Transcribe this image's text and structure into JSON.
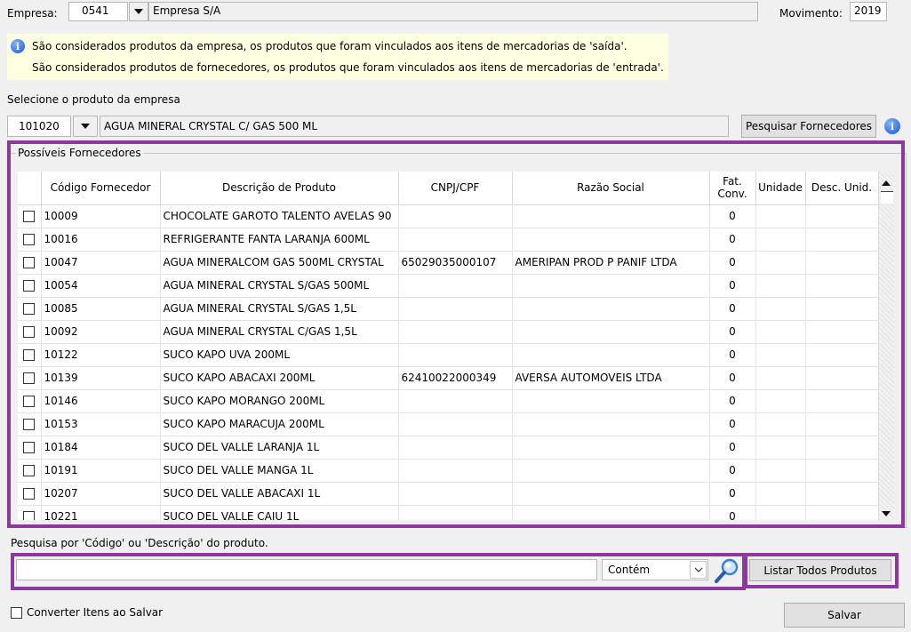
{
  "header": {
    "empresa_label": "Empresa:",
    "empresa_code": "0541",
    "empresa_name": "Empresa S/A",
    "movimento_label": "Movimento:",
    "movimento_value": "2019"
  },
  "info": {
    "line1": "São considerados produtos da empresa, os produtos que foram vinculados aos itens de mercadorias de 'saída'.",
    "line2": "São considerados produtos de fornecedores, os produtos que foram vinculados aos itens de mercadorias de 'entrada'."
  },
  "produto": {
    "label": "Selecione o produto da empresa",
    "code": "101020",
    "description": "AGUA MINERAL CRYSTAL C/ GAS 500 ML",
    "search_button": "Pesquisar Fornecedores"
  },
  "grid": {
    "group_title": "Possíveis Fornecedores",
    "columns": {
      "codigo": "Código Fornecedor",
      "descricao": "Descrição de Produto",
      "cnpj": "CNPJ/CPF",
      "razao": "Razão Social",
      "fat_line1": "Fat.",
      "fat_line2": "Conv.",
      "unidade": "Unidade",
      "desc_unid": "Desc. Unid."
    },
    "rows": [
      {
        "codigo": "10009",
        "descricao": "CHOCOLATE GAROTO TALENTO AVELAS 90",
        "cnpj": "",
        "razao": "",
        "fat": "0"
      },
      {
        "codigo": "10016",
        "descricao": "REFRIGERANTE FANTA LARANJA 600ML",
        "cnpj": "",
        "razao": "",
        "fat": "0"
      },
      {
        "codigo": "10047",
        "descricao": "AGUA MINERALCOM GAS 500ML CRYSTAL",
        "cnpj": "65029035000107",
        "razao": "AMERIPAN PROD P PANIF LTDA",
        "fat": "0"
      },
      {
        "codigo": "10054",
        "descricao": "AGUA MINERAL CRYSTAL S/GAS 500ML",
        "cnpj": "",
        "razao": "",
        "fat": "0"
      },
      {
        "codigo": "10085",
        "descricao": "AGUA MINERAL CRYSTAL S/GAS 1,5L",
        "cnpj": "",
        "razao": "",
        "fat": "0"
      },
      {
        "codigo": "10092",
        "descricao": "AGUA MINERAL CRYSTAL C/GAS 1,5L",
        "cnpj": "",
        "razao": "",
        "fat": "0"
      },
      {
        "codigo": "10122",
        "descricao": "SUCO KAPO UVA 200ML",
        "cnpj": "",
        "razao": "",
        "fat": "0"
      },
      {
        "codigo": "10139",
        "descricao": "SUCO KAPO ABACAXI 200ML",
        "cnpj": "62410022000349",
        "razao": "AVERSA AUTOMOVEIS LTDA",
        "fat": "0"
      },
      {
        "codigo": "10146",
        "descricao": "SUCO KAPO MORANGO 200ML",
        "cnpj": "",
        "razao": "",
        "fat": "0"
      },
      {
        "codigo": "10153",
        "descricao": "SUCO KAPO MARACUJA 200ML",
        "cnpj": "",
        "razao": "",
        "fat": "0"
      },
      {
        "codigo": "10184",
        "descricao": "SUCO DEL VALLE LARANJA 1L",
        "cnpj": "",
        "razao": "",
        "fat": "0"
      },
      {
        "codigo": "10191",
        "descricao": "SUCO DEL VALLE MANGA 1L",
        "cnpj": "",
        "razao": "",
        "fat": "0"
      },
      {
        "codigo": "10207",
        "descricao": "SUCO DEL VALLE ABACAXI 1L",
        "cnpj": "",
        "razao": "",
        "fat": "0"
      },
      {
        "codigo": "10221",
        "descricao": "SUCO DEL VALLE CAJU 1L",
        "cnpj": "",
        "razao": "",
        "fat": "0"
      }
    ]
  },
  "search": {
    "label": "Pesquisa por 'Código' ou 'Descrição' do produto.",
    "value": "",
    "mode_selected": "Contém",
    "list_all_button": "Listar Todos Produtos"
  },
  "footer": {
    "convert_label": "Converter Itens ao Salvar",
    "save_button": "Salvar"
  },
  "colors": {
    "highlight": "#8b3a9b",
    "info_background": "#ffffe1",
    "window_background": "#f0f0f0"
  }
}
